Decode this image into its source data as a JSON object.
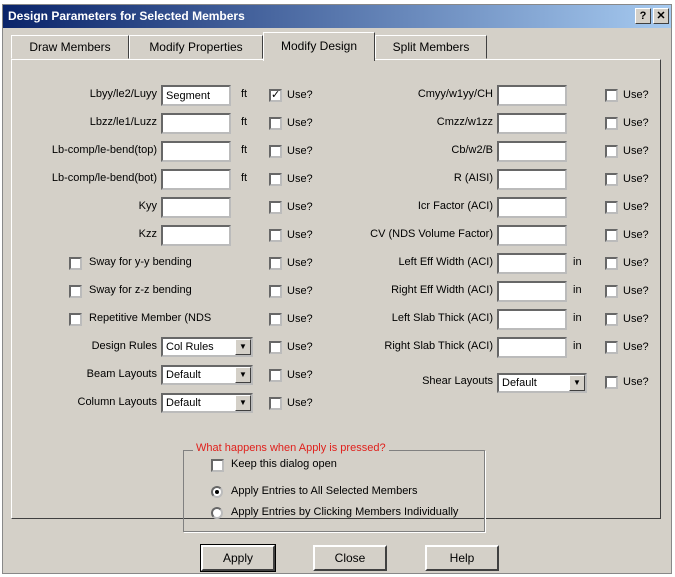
{
  "window": {
    "title": "Design Parameters for Selected Members",
    "help_glyph": "?",
    "close_glyph": "✕"
  },
  "tabs": [
    "Draw Members",
    "Modify Properties",
    "Modify Design",
    "Split Members"
  ],
  "active_tab": 2,
  "left_rows": [
    {
      "label": "Lbyy/le2/Luyy",
      "value": "Segment",
      "unit": "ft",
      "use_label": "Use?",
      "use_checked": true
    },
    {
      "label": "Lbzz/le1/Luzz",
      "value": "",
      "unit": "ft",
      "use_label": "Use?",
      "use_checked": false
    },
    {
      "label": "Lb-comp/le-bend(top)",
      "value": "",
      "unit": "ft",
      "use_label": "Use?",
      "use_checked": false
    },
    {
      "label": "Lb-comp/le-bend(bot)",
      "value": "",
      "unit": "ft",
      "use_label": "Use?",
      "use_checked": false
    },
    {
      "label": "Kyy",
      "value": "",
      "unit": "",
      "use_label": "Use?",
      "use_checked": false
    },
    {
      "label": "Kzz",
      "value": "",
      "unit": "",
      "use_label": "Use?",
      "use_checked": false
    }
  ],
  "left_checks": [
    {
      "label": "Sway for y-y bending",
      "use_label": "Use?"
    },
    {
      "label": "Sway for z-z bending",
      "use_label": "Use?"
    },
    {
      "label": "Repetitive Member (NDS",
      "use_label": "Use?"
    }
  ],
  "left_selects": [
    {
      "label": "Design Rules",
      "value": "Col Rules",
      "use_label": "Use?"
    },
    {
      "label": "Beam Layouts",
      "value": "Default",
      "use_label": "Use?"
    },
    {
      "label": "Column Layouts",
      "value": "Default",
      "use_label": "Use?"
    }
  ],
  "right_rows": [
    {
      "label": "Cmyy/w1yy/CH",
      "unit": "",
      "use_label": "Use?"
    },
    {
      "label": "Cmzz/w1zz",
      "unit": "",
      "use_label": "Use?"
    },
    {
      "label": "Cb/w2/B",
      "unit": "",
      "use_label": "Use?"
    },
    {
      "label": "R (AISI)",
      "unit": "",
      "use_label": "Use?"
    },
    {
      "label": "Icr Factor (ACI)",
      "unit": "",
      "use_label": "Use?"
    },
    {
      "label": "CV (NDS Volume Factor)",
      "unit": "",
      "use_label": "Use?"
    },
    {
      "label": "Left Eff Width (ACI)",
      "unit": "in",
      "use_label": "Use?"
    },
    {
      "label": "Right Eff Width (ACI)",
      "unit": "in",
      "use_label": "Use?"
    },
    {
      "label": "Left Slab Thick (ACI)",
      "unit": "in",
      "use_label": "Use?"
    },
    {
      "label": "Right Slab Thick (ACI)",
      "unit": "in",
      "use_label": "Use?"
    }
  ],
  "shear": {
    "label": "Shear Layouts",
    "value": "Default",
    "use_label": "Use?"
  },
  "apply_group": {
    "legend": "What happens when Apply is pressed?",
    "keep_open": "Keep this dialog open",
    "radio_all": "Apply Entries to All Selected Members",
    "radio_click": "Apply Entries by Clicking Members Individually"
  },
  "buttons": {
    "apply": "Apply",
    "close": "Close",
    "help": "Help"
  },
  "colors": {
    "legend_red": "#e0201c",
    "titlebar": "#0a246a"
  }
}
